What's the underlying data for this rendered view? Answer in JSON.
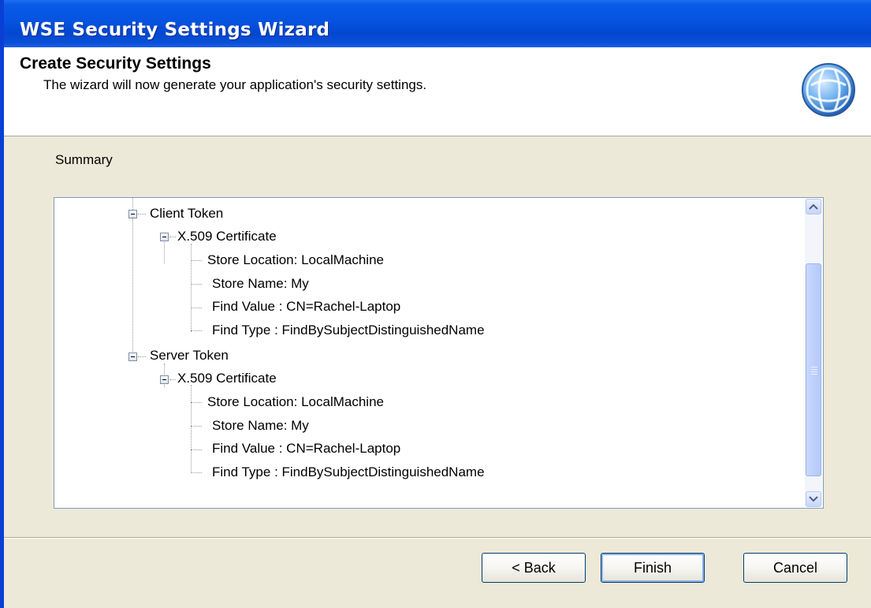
{
  "window": {
    "title": "WSE Security Settings Wizard"
  },
  "header": {
    "title": "Create Security Settings",
    "subtitle": "The wizard will now generate your application's security settings."
  },
  "summary": {
    "label": "Summary",
    "client": {
      "label": "Client Token",
      "cert": "X.509 Certificate",
      "items": [
        "Store Location: LocalMachine",
        "Store Name: My",
        "Find Value : CN=Rachel-Laptop",
        "Find Type : FindBySubjectDistinguishedName"
      ]
    },
    "server": {
      "label": "Server Token",
      "cert": "X.509 Certificate",
      "items": [
        "Store Location: LocalMachine",
        "Store Name: My",
        "Find Value : CN=Rachel-Laptop",
        "Find Type : FindBySubjectDistinguishedName"
      ]
    }
  },
  "buttons": {
    "back": "< Back",
    "finish": "Finish",
    "cancel": "Cancel"
  },
  "icons": {
    "header": "globe-icon",
    "scroll_up": "chevron-up-icon",
    "scroll_down": "chevron-down-icon",
    "tree_toggle": "collapse-icon"
  },
  "colors": {
    "titlebar": "#0653e0",
    "dialog_bg": "#ece9d8",
    "tree_border": "#7f9db9"
  }
}
